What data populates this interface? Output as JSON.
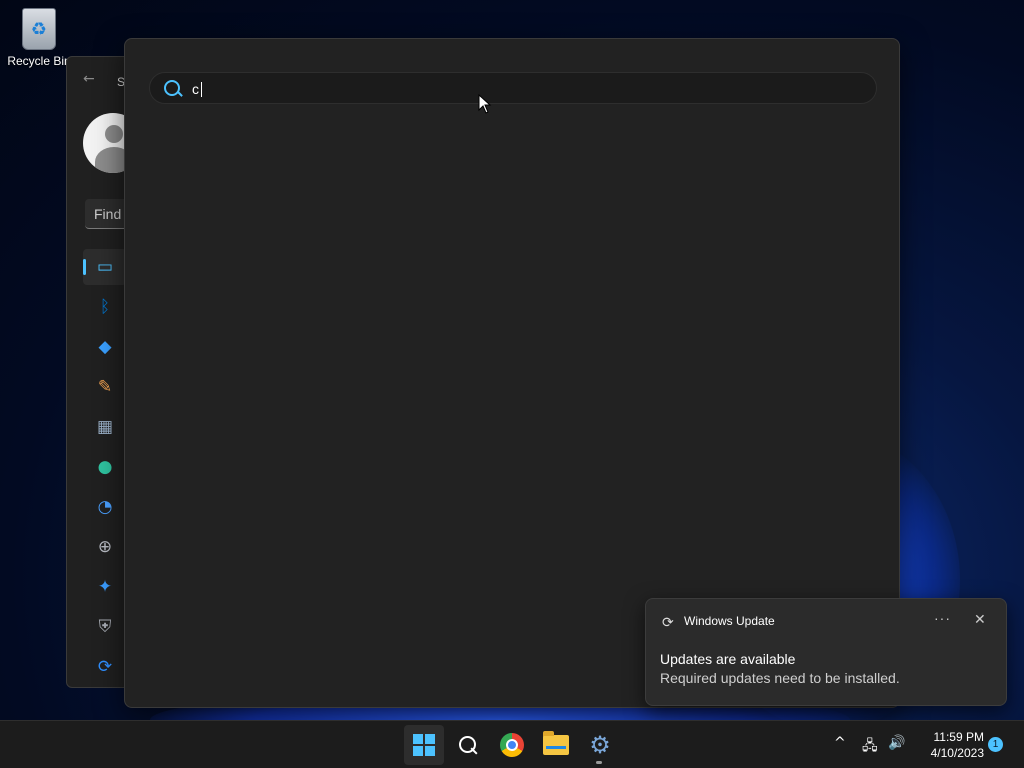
{
  "desktop": {
    "recycle_bin_label": "Recycle Bin"
  },
  "settings_window": {
    "title": "S",
    "search_placeholder": "Find",
    "nav_items": [
      {
        "name": "system",
        "icon": "monitor-icon",
        "glyph": "▭",
        "color": "#4cc2ff",
        "selected": true
      },
      {
        "name": "bluetooth",
        "icon": "bluetooth-icon",
        "glyph": "ᛒ",
        "color": "#0078d4",
        "selected": false
      },
      {
        "name": "network",
        "icon": "wifi-icon",
        "glyph": "◆",
        "color": "#3aa0ff",
        "selected": false
      },
      {
        "name": "personalization",
        "icon": "brush-icon",
        "glyph": "✎",
        "color": "#f0a050",
        "selected": false
      },
      {
        "name": "apps",
        "icon": "apps-icon",
        "glyph": "▦",
        "color": "#9ab0c8",
        "selected": false
      },
      {
        "name": "accounts",
        "icon": "person-icon",
        "glyph": "●",
        "color": "#2fc3a0",
        "selected": false
      },
      {
        "name": "time-language",
        "icon": "clock-globe-icon",
        "glyph": "◔",
        "color": "#4aa0ff",
        "selected": false
      },
      {
        "name": "gaming",
        "icon": "gamepad-icon",
        "glyph": "⊕",
        "color": "#b8bcc4",
        "selected": false
      },
      {
        "name": "accessibility",
        "icon": "accessibility-icon",
        "glyph": "✦",
        "color": "#3a9cff",
        "selected": false
      },
      {
        "name": "privacy-security",
        "icon": "shield-icon",
        "glyph": "⛨",
        "color": "#a8acb4",
        "selected": false
      },
      {
        "name": "windows-update",
        "icon": "update-icon",
        "glyph": "⟳",
        "color": "#2f8fff",
        "selected": false
      }
    ]
  },
  "search": {
    "query": "c",
    "icon": "search-icon"
  },
  "notification": {
    "app_name": "Windows Update",
    "app_icon": "sync-icon",
    "more_label": "···",
    "close_label": "✕",
    "title": "Updates are available",
    "body": "Required updates need to be installed."
  },
  "taskbar": {
    "apps": [
      {
        "name": "start",
        "icon": "windows-logo-icon",
        "active": true
      },
      {
        "name": "search",
        "icon": "search-icon",
        "active": false
      },
      {
        "name": "chrome",
        "icon": "chrome-icon",
        "active": false
      },
      {
        "name": "file-explorer",
        "icon": "folder-icon",
        "active": false
      },
      {
        "name": "settings",
        "icon": "gear-icon",
        "active": false,
        "running": true
      }
    ],
    "tray": {
      "chevron": "^",
      "network_icon": "network-icon",
      "volume_icon": "volume-icon"
    },
    "clock": {
      "time": "11:59 PM",
      "date": "4/10/2023"
    },
    "notification_count": "1"
  }
}
